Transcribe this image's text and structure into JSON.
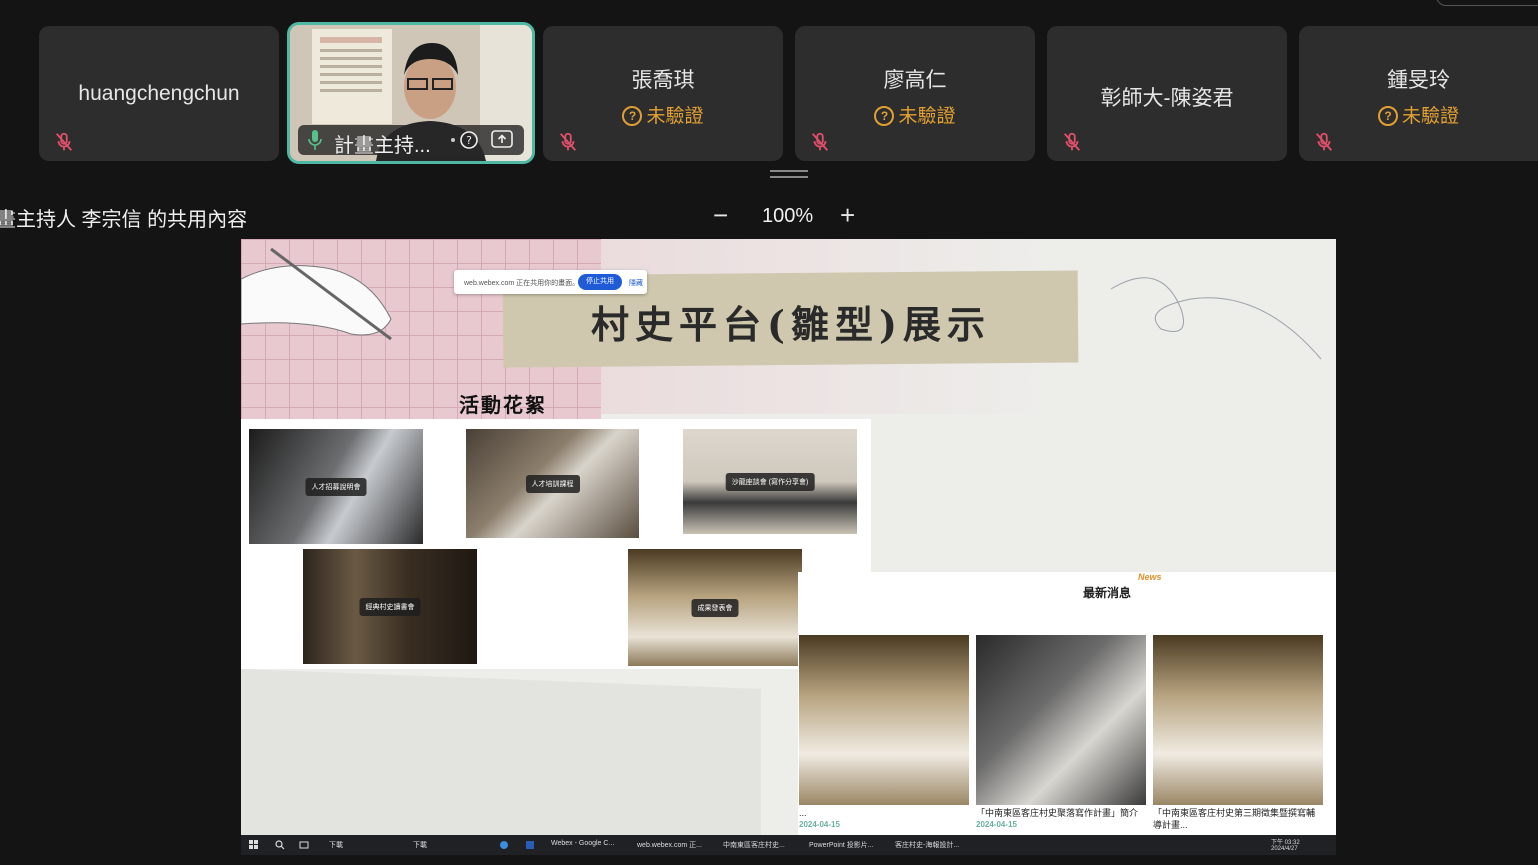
{
  "participants": [
    {
      "name": "huangchengchun",
      "verified_label": ""
    },
    {
      "name": "張喬琪",
      "verified_label": "未驗證"
    },
    {
      "name": "廖高仁",
      "verified_label": "未驗證"
    },
    {
      "name": "彰師大-陳姿君",
      "verified_label": ""
    },
    {
      "name": "鍾旻玲",
      "verified_label": "未驗證"
    }
  ],
  "active_speaker": {
    "label": "計畫主持..."
  },
  "share": {
    "title": "畫主持人  李宗信 的共用內容",
    "zoom_minus": "−",
    "zoom_level": "100%",
    "zoom_plus": "+"
  },
  "slide": {
    "title": "村史平台(雛型)展示",
    "webex_notice": "web.webex.com 正在共用你的畫面。",
    "webex_stop": "停止共用",
    "webex_hide": "隱藏",
    "activity_heading": "活動花絮",
    "photos": [
      {
        "caption": "人才招募說明會"
      },
      {
        "caption": "人才培訓課程"
      },
      {
        "caption": "沙龍座談會 (寫作分享會)"
      },
      {
        "caption": "經典村史讀書會"
      },
      {
        "caption": "成果發表會"
      }
    ],
    "news_heading": "最新消息",
    "news_tag": "News",
    "news": [
      {
        "title": "...",
        "date": "2024-04-15"
      },
      {
        "title": "「中南東區客庄村史聚落寫作計畫」簡介",
        "date": "2024-04-15"
      },
      {
        "title": "「中南東區客庄村史第三期徵集暨撰寫輔導計畫...",
        "date": ""
      }
    ]
  },
  "taskbar": {
    "items": [
      "下載",
      "下載",
      "Webex - Google C...",
      "web.webex.com 正...",
      "中南東區客庄村史...",
      "PowerPoint 投影片...",
      "客庄村史-海報設計..."
    ],
    "clock_time": "下午 03:32",
    "clock_date": "2024/4/27"
  }
}
